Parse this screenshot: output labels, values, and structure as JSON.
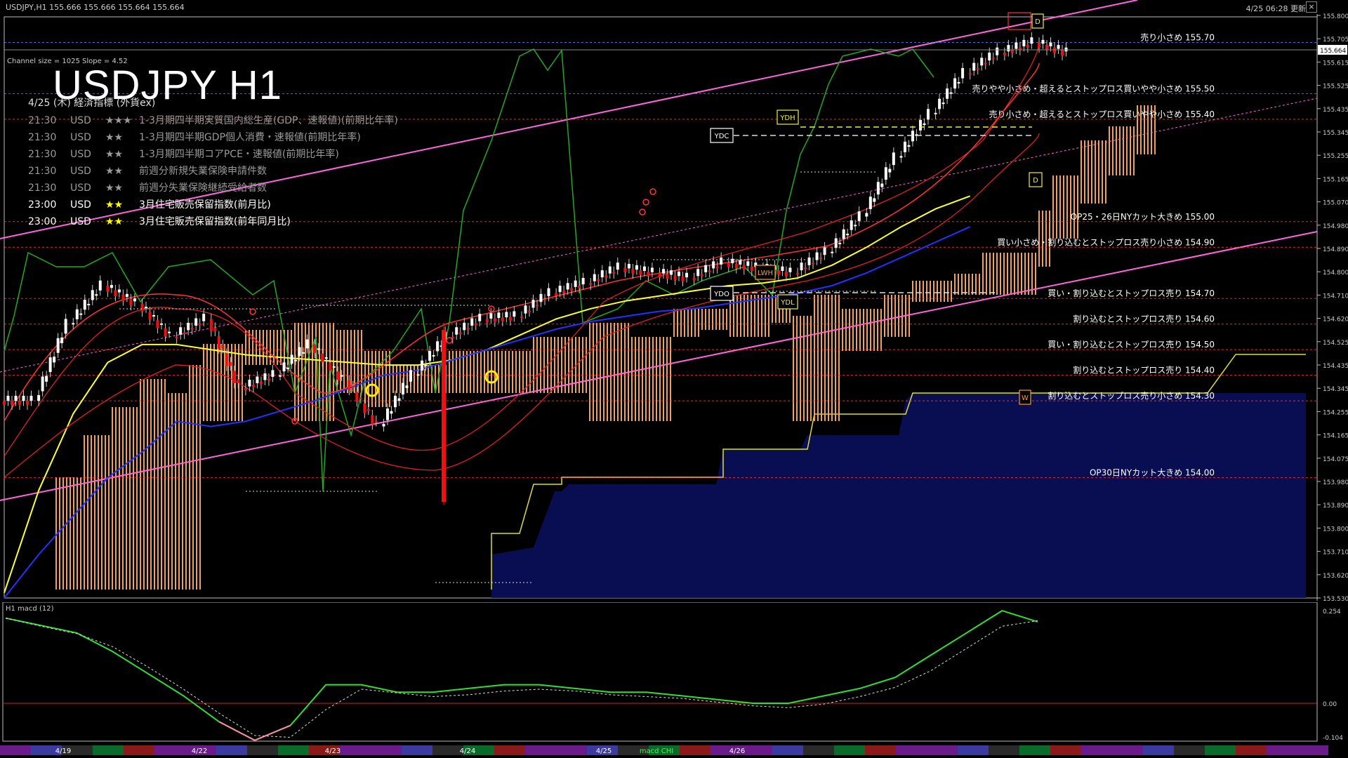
{
  "window": {
    "symbol_line": "USDJPY,H1  155.666 155.666 155.664 155.664",
    "datetime": "4/25 06:28 更新",
    "close_label": "×"
  },
  "overlay": {
    "channel_info": "Channel size = 1025 Slope = 4.52",
    "title": "USDJPY H1"
  },
  "events": {
    "header": "4/25 (木) 経済指標 (外貨ex)",
    "rows": [
      {
        "time": "21:30",
        "cur": "USD",
        "stars": "★★★",
        "text": "1-3月期四半期実質国内総生産(GDP、速報値)(前期比年率)",
        "color": "#9a9a9a"
      },
      {
        "time": "21:30",
        "cur": "USD",
        "stars": "★★",
        "text": "1-3月期四半期GDP個人消費・速報値(前期比年率)",
        "color": "#9a9a9a"
      },
      {
        "time": "21:30",
        "cur": "USD",
        "stars": "★★",
        "text": "1-3月期四半期コアPCE・速報値(前期比年率)",
        "color": "#9a9a9a"
      },
      {
        "time": "21:30",
        "cur": "USD",
        "stars": "★★",
        "text": "前週分新規失業保険申請件数",
        "color": "#9a9a9a"
      },
      {
        "time": "21:30",
        "cur": "USD",
        "stars": "★★",
        "text": "前週分失業保険継続受給者数",
        "color": "#9a9a9a"
      },
      {
        "time": "23:00",
        "cur": "USD",
        "stars": "★★",
        "text": "3月住宅販売保留指数(前月比)",
        "color": "#ffffff",
        "star_color": "#ffff00"
      },
      {
        "time": "23:00",
        "cur": "USD",
        "stars": "★★",
        "text": "3月住宅販売保留指数(前年同月比)",
        "color": "#ffffff",
        "star_color": "#ffff00"
      }
    ]
  },
  "price_axis": {
    "labels": [
      "155.800",
      "155.705",
      "155.615",
      "155.525",
      "155.435",
      "155.345",
      "155.255",
      "155.165",
      "155.070",
      "154.980",
      "154.890",
      "154.800",
      "154.710",
      "154.620",
      "154.525",
      "154.435",
      "154.345",
      "154.255",
      "154.165",
      "154.075",
      "153.980",
      "153.890",
      "153.800",
      "153.710",
      "153.620",
      "153.530"
    ],
    "current": "155.664"
  },
  "order_levels": [
    {
      "price": 155.7,
      "text": "売り小さめ 155.70",
      "color": "#6688ff"
    },
    {
      "price": 155.5,
      "text": "売りやや小さめ・超えるとストップロス買いやや小さめ 155.50",
      "color": "#6688ff"
    },
    {
      "price": 155.4,
      "text": "売り小さめ・超えるとストップロス買いやや小さめ 155.40",
      "color": "#ff4444"
    },
    {
      "price": 155.0,
      "text": "OP25・26日NYカット大きめ 155.00",
      "color": "#ff4444"
    },
    {
      "price": 154.9,
      "text": "買い小さめ・割り込むとストップロス売り小さめ 154.90",
      "color": "#ff4444"
    },
    {
      "price": 154.7,
      "text": "買い・割り込むとストップロス売り 154.70",
      "color": "#ff4444"
    },
    {
      "price": 154.6,
      "text": "割り込むとストップロス売り 154.60",
      "color": "#ff4444"
    },
    {
      "price": 154.5,
      "text": "買い・割り込むとストップロス売り 154.50",
      "color": "#ff4444"
    },
    {
      "price": 154.4,
      "text": "割り込むとストップロス売り 154.40",
      "color": "#ff4444"
    },
    {
      "price": 154.3,
      "text": "割り込むとストップロス売り小さめ 154.30",
      "color": "#ff4444"
    },
    {
      "price": 154.0,
      "text": "OP30日NYカット大きめ 154.00",
      "color": "#ff4444"
    }
  ],
  "markers": [
    "YDH",
    "YDC",
    "YDO",
    "YDL",
    "LWH",
    "D",
    "W"
  ],
  "macd": {
    "label": "H1  macd (12)",
    "axis": [
      "0.254",
      "0.00",
      "-0.104"
    ],
    "sub_label": "macd CHI"
  },
  "date_labels": [
    "4/19",
    "4/22",
    "4/23",
    "4/24",
    "4/25",
    "4/26"
  ],
  "chart_data": {
    "type": "line",
    "title": "USDJPY H1",
    "ylim": [
      153.53,
      155.8
    ],
    "x": [
      0,
      10,
      20,
      30,
      40,
      50,
      60,
      70,
      80,
      90,
      100,
      110,
      120,
      130,
      140,
      150,
      160,
      170,
      180,
      190,
      200,
      210,
      220,
      230,
      240,
      250,
      260,
      270,
      280,
      290,
      300
    ],
    "series": [
      {
        "name": "close",
        "values": [
          154.3,
          154.6,
          154.75,
          154.68,
          154.55,
          154.62,
          154.35,
          154.4,
          154.52,
          154.38,
          154.2,
          154.4,
          154.55,
          154.62,
          154.63,
          154.72,
          154.76,
          154.82,
          154.8,
          154.78,
          154.84,
          154.82,
          154.8,
          154.88,
          155.02,
          155.25,
          155.42,
          155.58,
          155.66,
          155.7,
          155.66
        ],
        "color": "#ffffff"
      },
      {
        "name": "ma_yellow",
        "values": [
          153.55,
          153.95,
          154.25,
          154.45,
          154.52,
          154.52,
          154.5,
          154.48,
          154.47,
          154.46,
          154.45,
          154.44,
          154.44,
          154.46,
          154.5,
          154.56,
          154.62,
          154.66,
          154.69,
          154.71,
          154.73,
          154.75,
          154.76,
          154.78,
          154.83,
          154.9,
          154.98,
          155.05,
          155.1
        ],
        "color": "#ffff33"
      },
      {
        "name": "ma_blue",
        "values": [
          153.53,
          153.7,
          153.85,
          154.0,
          154.1,
          154.22,
          154.2,
          154.22,
          154.26,
          154.3,
          154.35,
          154.4,
          154.42,
          154.46,
          154.5,
          154.54,
          154.58,
          154.61,
          154.63,
          154.65,
          154.66,
          154.68,
          154.7,
          154.72,
          154.75,
          154.8,
          154.86,
          154.92,
          154.98
        ],
        "color": "#2233ff"
      },
      {
        "name": "macd",
        "values": [
          0.23,
          0.21,
          0.19,
          0.14,
          0.08,
          0.02,
          -0.05,
          -0.1,
          -0.06,
          0.05,
          0.05,
          0.03,
          0.03,
          0.04,
          0.05,
          0.05,
          0.04,
          0.03,
          0.03,
          0.02,
          0.01,
          0.0,
          0.0,
          0.02,
          0.04,
          0.07,
          0.13,
          0.19,
          0.25,
          0.22
        ],
        "color": "#33dd33"
      }
    ]
  }
}
